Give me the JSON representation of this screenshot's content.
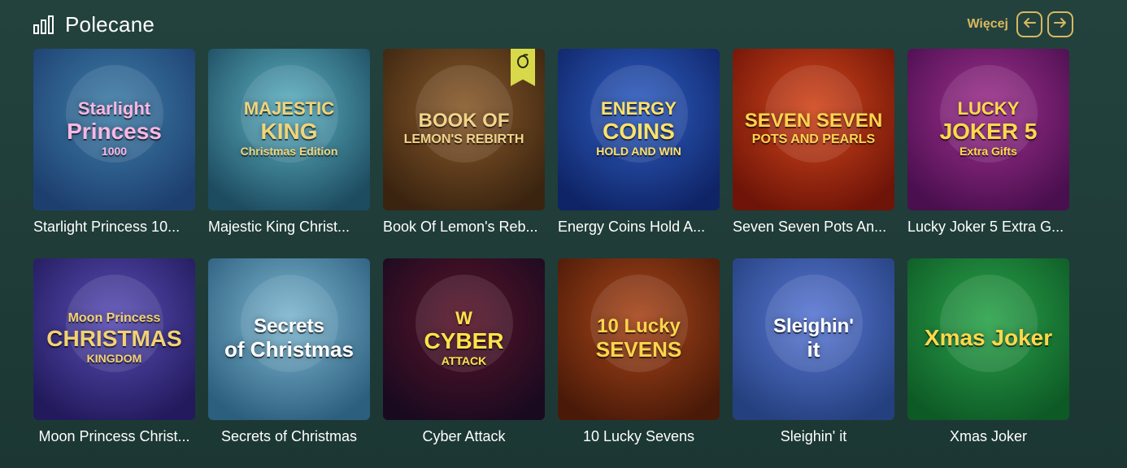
{
  "header": {
    "title": "Polecane",
    "title_icon": "chart-bars-icon",
    "more_label": "Więcej",
    "prev_icon": "arrow-left-icon",
    "next_icon": "arrow-right-icon",
    "accent_color": "#d9b85e"
  },
  "games": [
    {
      "name": "Starlight Princess 10...",
      "art": [
        "Starlight",
        "Princess",
        "1000"
      ],
      "colors": [
        "#3f7fa8",
        "#1d3f70"
      ],
      "text_color": "#f7b7e3"
    },
    {
      "name": "Majestic King Christ...",
      "art": [
        "MAJESTIC",
        "KING",
        "Christmas Edition"
      ],
      "colors": [
        "#5fb4c6",
        "#1d4b5f"
      ],
      "text_color": "#f0d47a"
    },
    {
      "name": "Book Of Lemon's Reb...",
      "art": [
        "BOOK OF",
        "LEMON'S REBIRTH"
      ],
      "colors": [
        "#8a5a2a",
        "#3a2410"
      ],
      "text_color": "#f2d38a",
      "badge_icon": "lemon-badge-icon"
    },
    {
      "name": "Energy Coins Hold A...",
      "art": [
        "ENERGY",
        "COINS",
        "HOLD AND WIN"
      ],
      "colors": [
        "#2f5fc4",
        "#0f2466"
      ],
      "text_color": "#ffe26a"
    },
    {
      "name": "Seven Seven Pots An...",
      "art": [
        "SEVEN SEVEN",
        "POTS AND PEARLS"
      ],
      "colors": [
        "#d3461b",
        "#6e1408"
      ],
      "text_color": "#ffd34f"
    },
    {
      "name": "Lucky Joker 5 Extra G...",
      "art": [
        "LUCKY",
        "JOKER 5",
        "Extra Gifts"
      ],
      "colors": [
        "#a0308f",
        "#4a0f4e"
      ],
      "text_color": "#ffd94a"
    },
    {
      "name": "Moon Princess Christ...",
      "art": [
        "Moon Princess",
        "CHRISTMAS",
        "KINGDOM"
      ],
      "colors": [
        "#5a4fb8",
        "#221a5c"
      ],
      "text_color": "#f3d272"
    },
    {
      "name": "Secrets of Christmas",
      "art": [
        "Secrets",
        "of Christmas"
      ],
      "colors": [
        "#7fb9d2",
        "#2c5e7e"
      ],
      "text_color": "#ffffff"
    },
    {
      "name": "Cyber Attack",
      "art": [
        "W",
        "CYBER",
        "ATTACK"
      ],
      "colors": [
        "#5a1428",
        "#1a0a20"
      ],
      "text_color": "#ffe34a"
    },
    {
      "name": "10 Lucky Sevens",
      "art": [
        "10 Lucky",
        "SEVENS"
      ],
      "colors": [
        "#a9461a",
        "#4a1a08"
      ],
      "text_color": "#ffd54a"
    },
    {
      "name": "Sleighin' it",
      "art": [
        "Sleighin'",
        "it"
      ],
      "colors": [
        "#5a78d6",
        "#24407e"
      ],
      "text_color": "#ffffff"
    },
    {
      "name": "Xmas Joker",
      "art": [
        "Xmas Joker"
      ],
      "colors": [
        "#2aa34a",
        "#0e5a26"
      ],
      "text_color": "#ffd84a"
    }
  ]
}
